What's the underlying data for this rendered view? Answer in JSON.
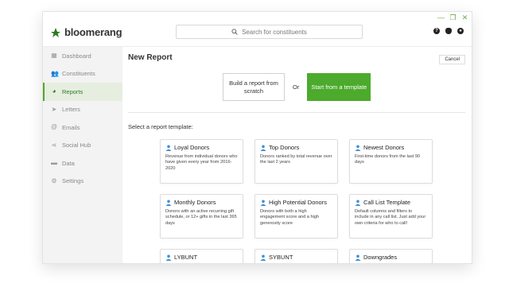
{
  "window_controls": [
    "—",
    "❐",
    "✕"
  ],
  "app": {
    "name": "bloomerang"
  },
  "search": {
    "placeholder": "Search for constituents"
  },
  "top_icons": [
    "help-icon",
    "bell-icon",
    "user-icon"
  ],
  "sidebar": {
    "items": [
      {
        "label": "Dashboard",
        "icon": "dashboard-icon",
        "active": false
      },
      {
        "label": "Constituents",
        "icon": "people-icon",
        "active": false
      },
      {
        "label": "Reports",
        "icon": "pie-chart-icon",
        "active": true
      },
      {
        "label": "Letters",
        "icon": "send-icon",
        "active": false
      },
      {
        "label": "Emails",
        "icon": "at-icon",
        "active": false
      },
      {
        "label": "Social Hub",
        "icon": "share-icon",
        "active": false
      },
      {
        "label": "Data",
        "icon": "folder-icon",
        "active": false
      },
      {
        "label": "Settings",
        "icon": "gear-icon",
        "active": false
      }
    ]
  },
  "main": {
    "title": "New Report",
    "cancel_label": "Cancel",
    "build_label": "Build a report from scratch",
    "or_label": "Or",
    "start_label": "Start from a template",
    "section_label": "Select a report template:"
  },
  "templates": [
    {
      "title": "Loyal Donors",
      "desc": "Revenue from individual donors who have given every year from 2016-2020"
    },
    {
      "title": "Top Donors",
      "desc": "Donors ranked by total revenue over the last 2 years"
    },
    {
      "title": "Newest Donors",
      "desc": "First-time donors from the last 90 days"
    },
    {
      "title": "Monthly Donors",
      "desc": "Donors with an active recurring gift schedule, or 12+ gifts in the last 365 days"
    },
    {
      "title": "High Potential Donors",
      "desc": "Donors with both a high engagement score and a high generosity score"
    },
    {
      "title": "Call List Template",
      "desc": "Default columns and filters to include in any call list. Just add your own criteria for who to call!"
    },
    {
      "title": "LYBUNT",
      "desc": ""
    },
    {
      "title": "SYBUNT",
      "desc": ""
    },
    {
      "title": "Downgrades",
      "desc": ""
    }
  ],
  "colors": {
    "brand_green": "#4caa2c",
    "active_green": "#2d7a1f",
    "sidebar_bg": "#f3f3f3",
    "icon_blue": "#3b8fd6"
  }
}
